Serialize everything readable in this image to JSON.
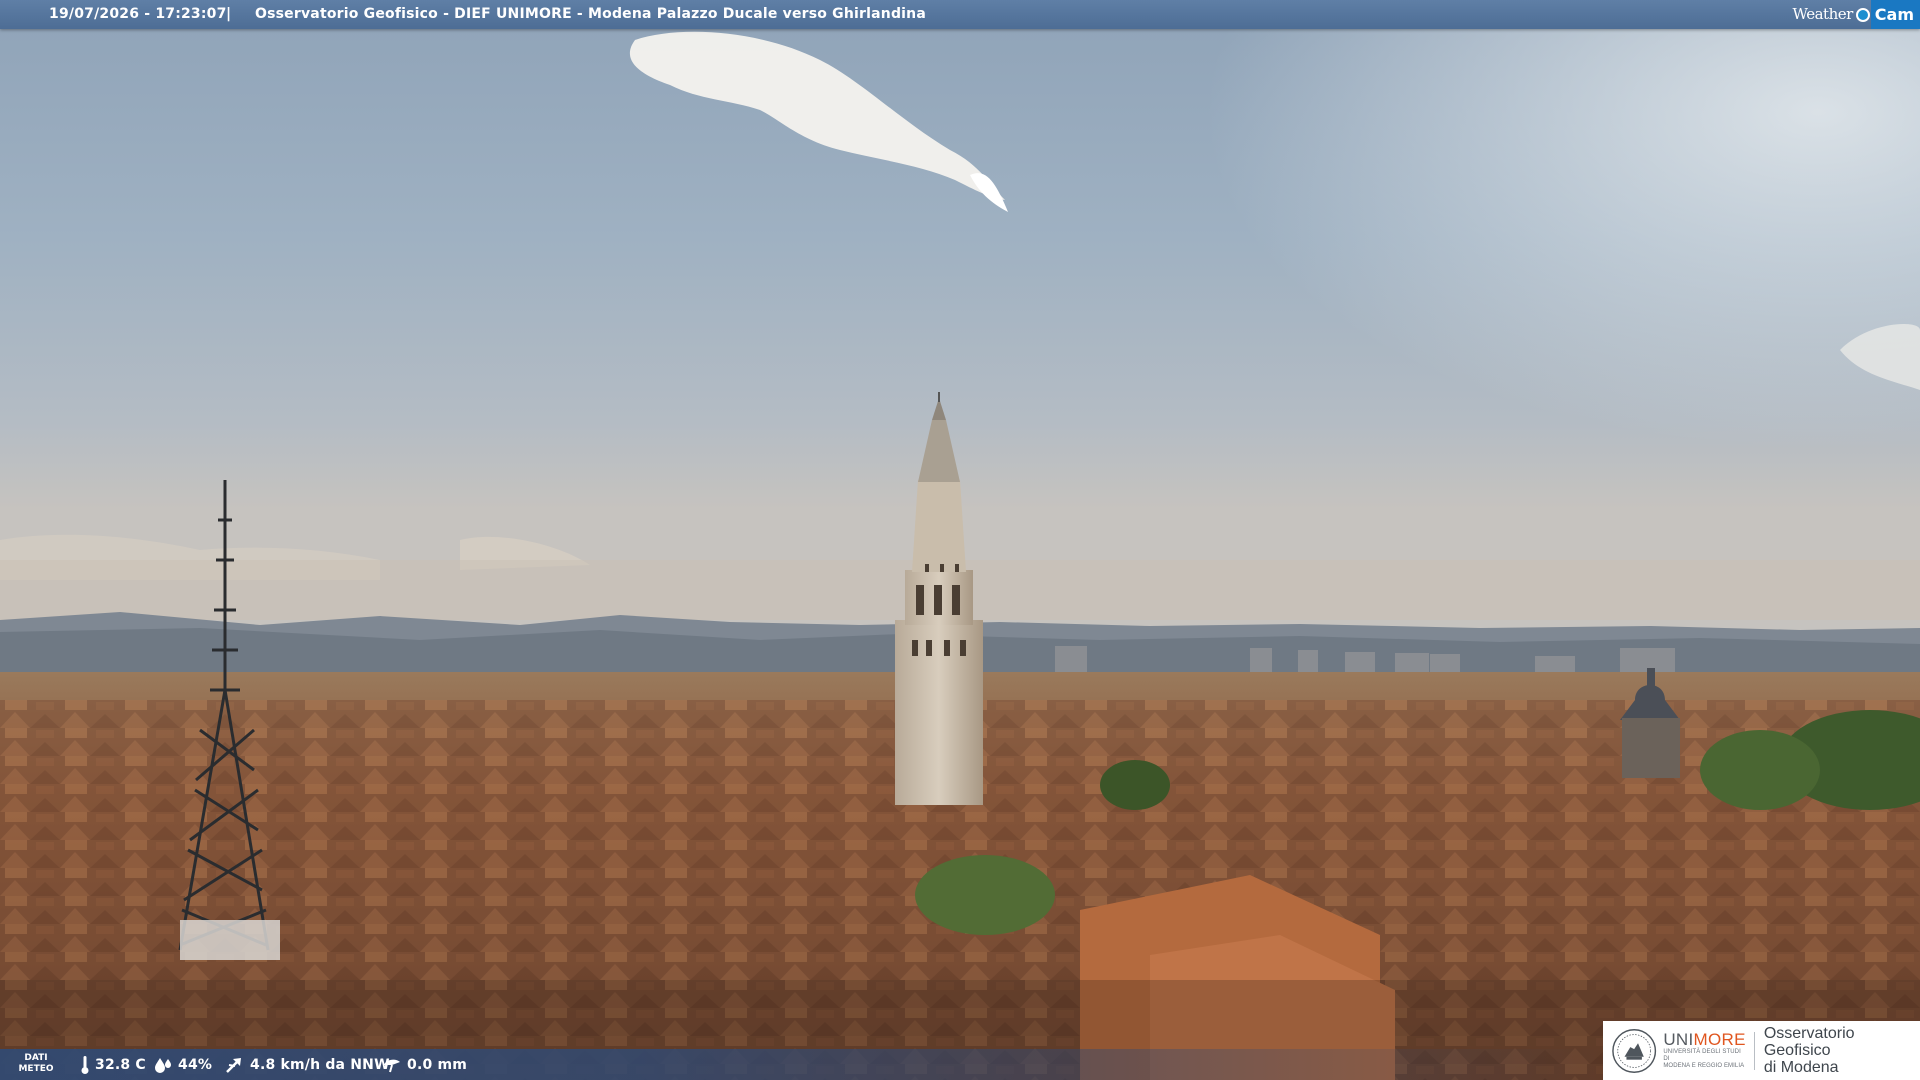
{
  "header": {
    "timestamp": "19/07/2026 - 17:23:07",
    "separator": "|",
    "title": "Osservatorio Geofisico - DIEF UNIMORE - Modena Palazzo Ducale verso Ghirlandina"
  },
  "branding": {
    "weather": "Weather",
    "cam": "Cam",
    "cam_color": "#1a78c2"
  },
  "weather_data": {
    "label_line1": "DATI",
    "label_line2": "METEO",
    "temperature": "32.8 C",
    "humidity": "44%",
    "wind": "4.8 km/h da NNW",
    "rain": "0.0 mm"
  },
  "badge": {
    "uni_part1": "UNI",
    "uni_part2": "MORE",
    "uni_sub1": "UNIVERSITÀ DEGLI STUDI DI",
    "uni_sub2": "MODENA E REGGIO EMILIA",
    "obs_line1": "Osservatorio Geofisico",
    "obs_line2": "di Modena",
    "accent_color": "#e0561f"
  },
  "scene": {
    "icons": [
      "thermometer-icon",
      "droplets-icon",
      "wind-icon",
      "rain-gauge-icon",
      "unimore-seal-icon"
    ]
  }
}
